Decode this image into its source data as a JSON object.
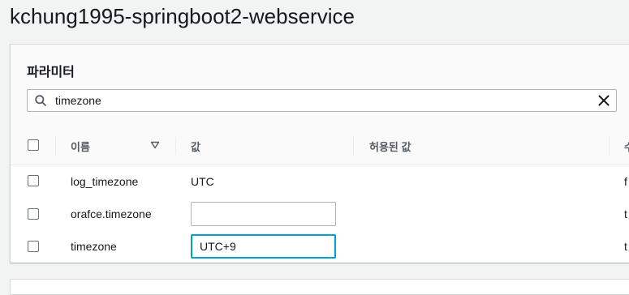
{
  "page": {
    "title": "kchung1995-springboot2-webservice"
  },
  "parameters_panel": {
    "title": "파라미터",
    "search": {
      "value": "timezone",
      "placeholder": ""
    },
    "table": {
      "columns": {
        "name": "이름",
        "value": "값",
        "allowed_values": "허용된 값",
        "next": "수"
      },
      "rows": [
        {
          "name": "log_timezone",
          "value": "UTC",
          "editable": false,
          "allowed_values": "",
          "next_partial": "f"
        },
        {
          "name": "orafce.timezone",
          "value": "",
          "editable": true,
          "allowed_values": "",
          "next_partial": "t"
        },
        {
          "name": "timezone",
          "value": "UTC+9",
          "editable": true,
          "focused": true,
          "allowed_values": "",
          "next_partial": "t"
        }
      ]
    }
  },
  "icons": {
    "search": "search-icon",
    "clear": "close-icon",
    "sort": "sort-down-icon"
  },
  "colors": {
    "focus_border": "#00a1c9",
    "header_text": "#545b64"
  }
}
